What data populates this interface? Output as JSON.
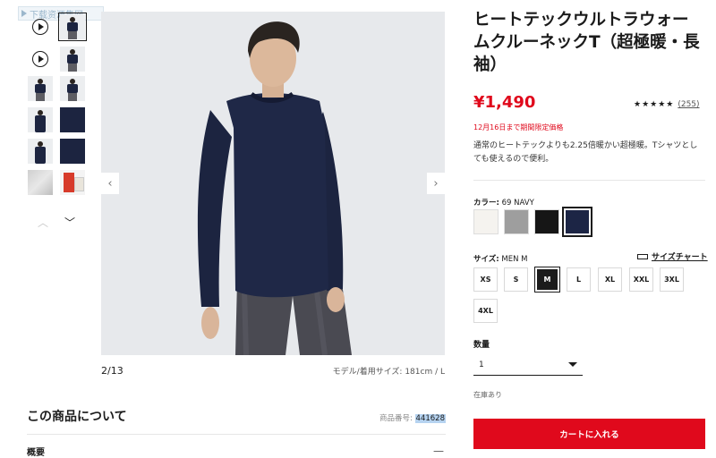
{
  "watermark": {
    "text": "下载资源集网"
  },
  "thumbnails": {
    "items": [
      {
        "kind": "video"
      },
      {
        "kind": "model-front"
      },
      {
        "kind": "video"
      },
      {
        "kind": "model-full"
      },
      {
        "kind": "model-full"
      },
      {
        "kind": "model-full"
      },
      {
        "kind": "model-upper"
      },
      {
        "kind": "fabric-navy"
      },
      {
        "kind": "model-back"
      },
      {
        "kind": "fabric-navy"
      },
      {
        "kind": "fabric-gray"
      },
      {
        "kind": "package"
      }
    ],
    "up_icon": "chevron-up-icon",
    "down_icon": "chevron-down-icon"
  },
  "gallery": {
    "position_label": "2/13",
    "model_info": "モデル/着用サイズ: 181cm / L"
  },
  "about": {
    "title": "この商品について",
    "code_label": "商品番号: ",
    "code_value": "441628",
    "overview_label": "概要",
    "overview_toggle": "—"
  },
  "product": {
    "title": "ヒートテックウルトラウォームクルーネックT（超極暖・長袖）",
    "price": "¥1,490",
    "stars": "★★★★★",
    "review_count": "(255)",
    "promo": "12月16日まで期間限定価格",
    "description": "通常のヒートテックよりも2.25倍暖かい超極暖。Tシャツとしても使えるので便利。"
  },
  "color": {
    "label": "カラー:",
    "selected_value": "69 NAVY",
    "swatches": [
      {
        "hex": "#f5f3ef"
      },
      {
        "hex": "#9e9e9e"
      },
      {
        "hex": "#161616"
      },
      {
        "hex": "#1c2545"
      }
    ],
    "selected_index": 3
  },
  "size": {
    "label": "サイズ:",
    "selected_value": "MEN M",
    "chart_link": "サイズチャート",
    "options": [
      "XS",
      "S",
      "M",
      "L",
      "XL",
      "XXL",
      "3XL",
      "4XL"
    ],
    "selected_index": 2
  },
  "quantity": {
    "label": "数量",
    "value": "1"
  },
  "stock": "在庫あり",
  "cart_button": "カートに入れる",
  "colors": {
    "accent_red": "#e0091c",
    "text": "#1b1b1b"
  }
}
